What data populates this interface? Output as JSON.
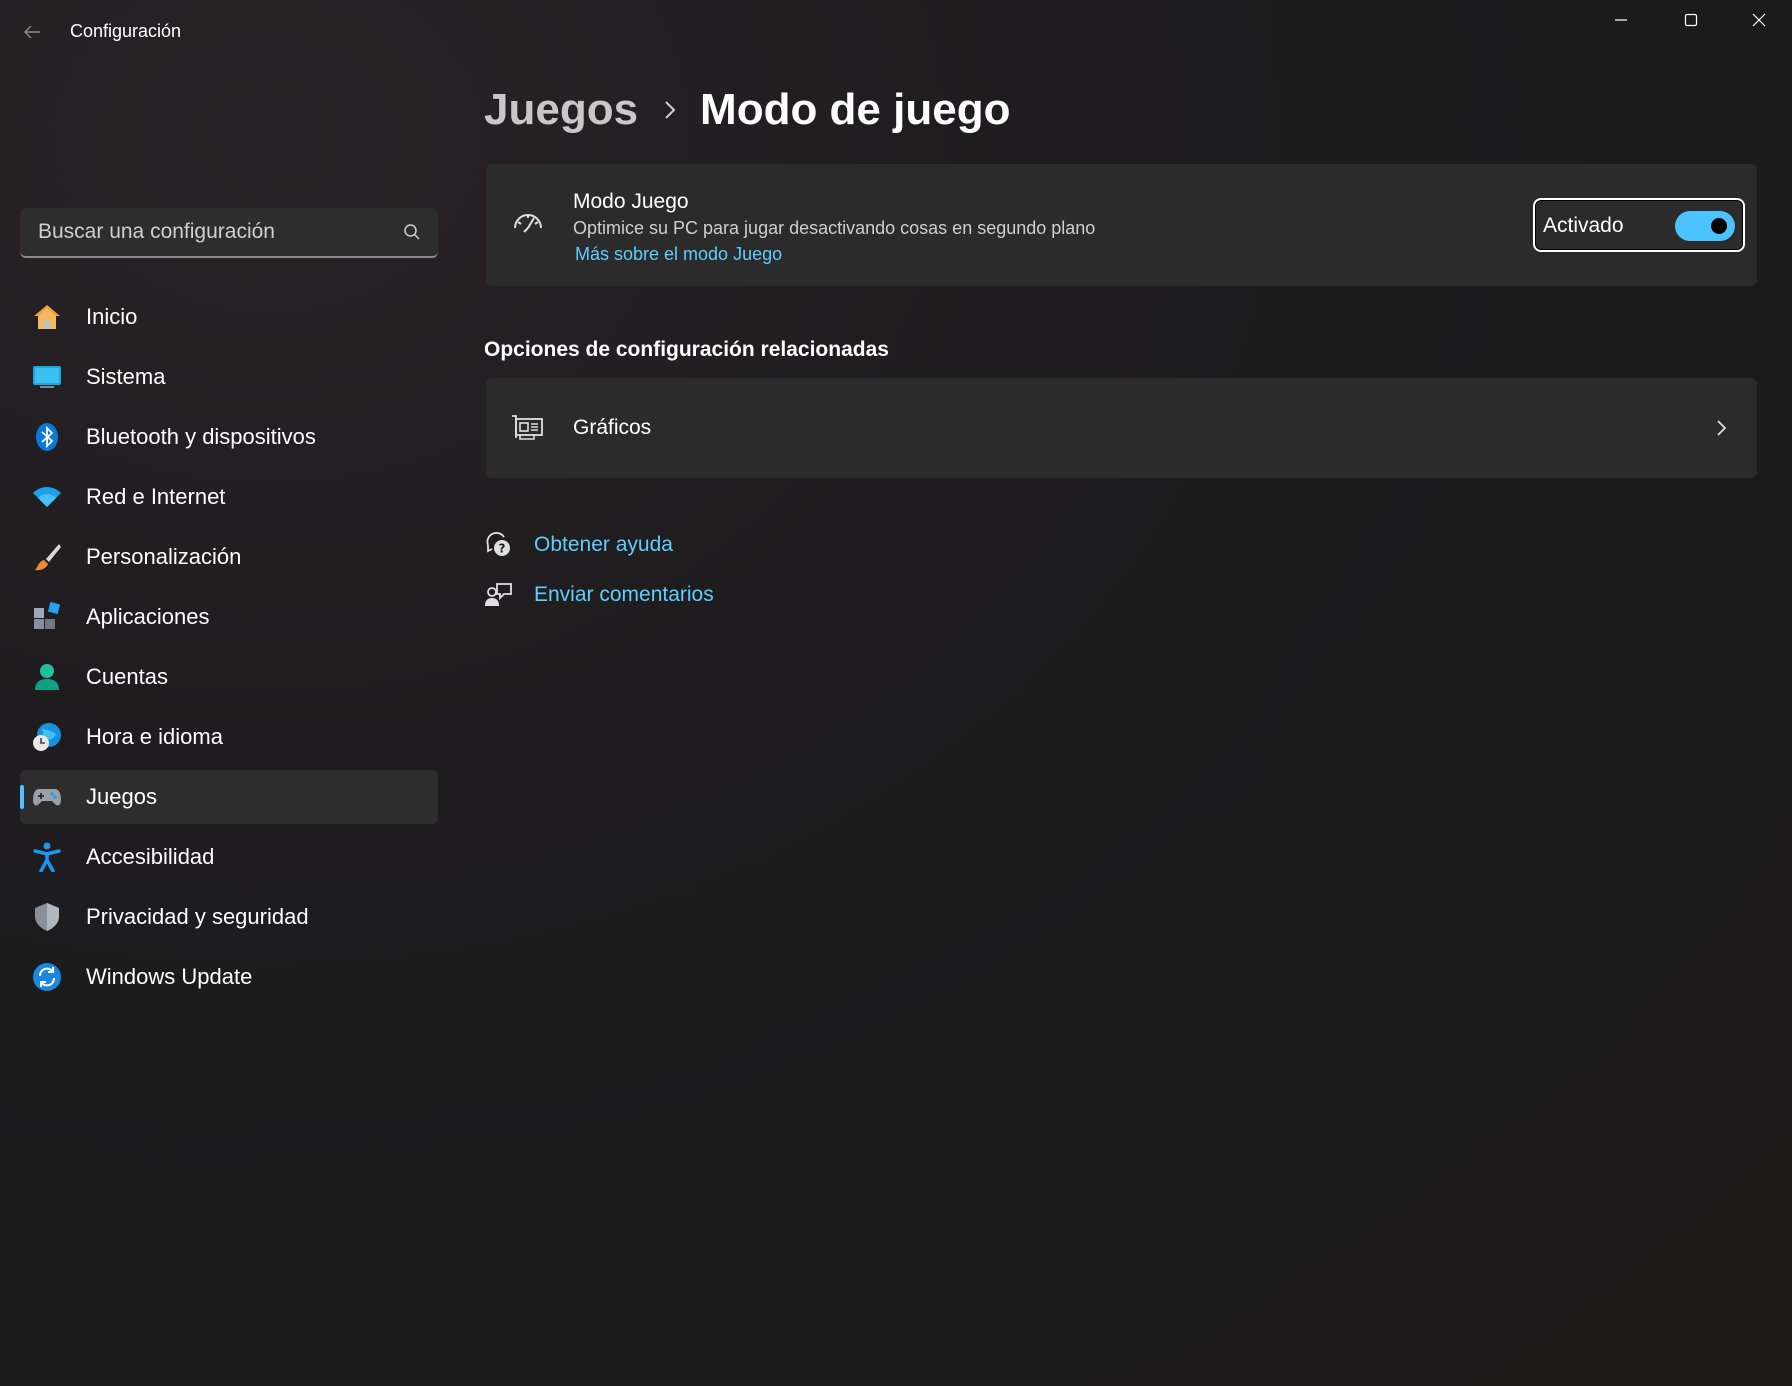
{
  "window": {
    "title": "Configuración"
  },
  "search": {
    "placeholder": "Buscar una configuración"
  },
  "sidebar": {
    "items": [
      {
        "label": "Inicio",
        "icon": "home-icon"
      },
      {
        "label": "Sistema",
        "icon": "monitor-icon"
      },
      {
        "label": "Bluetooth y dispositivos",
        "icon": "bluetooth-icon"
      },
      {
        "label": "Red e Internet",
        "icon": "wifi-icon"
      },
      {
        "label": "Personalización",
        "icon": "brush-icon"
      },
      {
        "label": "Aplicaciones",
        "icon": "apps-icon"
      },
      {
        "label": "Cuentas",
        "icon": "person-icon"
      },
      {
        "label": "Hora e idioma",
        "icon": "globe-clock-icon"
      },
      {
        "label": "Juegos",
        "icon": "gamepad-icon",
        "selected": true
      },
      {
        "label": "Accesibilidad",
        "icon": "accessibility-icon"
      },
      {
        "label": "Privacidad y seguridad",
        "icon": "shield-icon"
      },
      {
        "label": "Windows Update",
        "icon": "update-icon"
      }
    ]
  },
  "breadcrumb": {
    "parent": "Juegos",
    "current": "Modo de juego"
  },
  "game_mode": {
    "title": "Modo Juego",
    "description": "Optimice su PC para jugar desactivando cosas en segundo plano",
    "link": "Más sobre el modo Juego",
    "toggle_label": "Activado",
    "toggle_on": true
  },
  "related": {
    "title": "Opciones de configuración relacionadas",
    "graphics_label": "Gráficos"
  },
  "help": {
    "get_help": "Obtener ayuda",
    "send_feedback": "Enviar comentarios"
  },
  "colors": {
    "accent": "#4cc2ff",
    "link": "#60cdff",
    "card": "#2b2b2b"
  }
}
